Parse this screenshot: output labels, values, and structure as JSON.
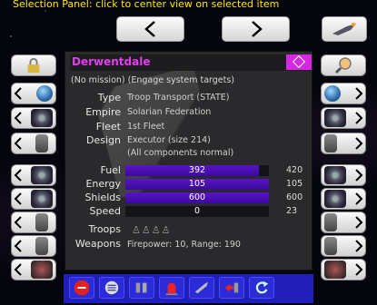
{
  "header": {
    "hint": "Selection Panel: click to center view on selected item"
  },
  "nav": {
    "prev_icon": "left-arrow-icon",
    "next_icon": "right-arrow-icon"
  },
  "item": {
    "name": "Derwentdale",
    "mission": "(No mission) (Engage system targets)",
    "fields": [
      {
        "label": "Type",
        "value": "Troop Transport (STATE)"
      },
      {
        "label": "Empire",
        "value": "Solarian Federation"
      },
      {
        "label": "Fleet",
        "value": "1st Fleet"
      },
      {
        "label": "Design",
        "value": "Executor (size 214)"
      }
    ],
    "components": "(All components normal)",
    "stats": [
      {
        "label": "Fuel",
        "value": "392",
        "max": "420",
        "fraction": 0.93
      },
      {
        "label": "Energy",
        "value": "105",
        "max": "105",
        "fraction": 1.0
      },
      {
        "label": "Shields",
        "value": "600",
        "max": "600",
        "fraction": 1.0
      },
      {
        "label": "Speed",
        "value": "0",
        "max": "23",
        "fraction": 0.0
      }
    ],
    "troops_label": "Troops",
    "troops_value": "♙♙♙♙",
    "weapons_label": "Weapons",
    "weapons_value": "Firepower: 10, Range: 190"
  },
  "colors": {
    "title": "#e23cf0",
    "bar_fill": "#4a10b8",
    "toolbar": "#2020b8"
  },
  "left_buttons": [
    "lock-icon",
    "planet-icon",
    "ship-icon",
    "troop-icon",
    "ship-icon",
    "ship-icon",
    "troop-icon",
    "troop-icon",
    "base-icon"
  ],
  "right_buttons": [
    "zoom-icon",
    "planet-icon",
    "ship-icon",
    "troop-icon",
    "ship-icon",
    "ship-icon",
    "troop-icon",
    "troop-icon",
    "base-icon"
  ],
  "toolbar": [
    "stop-icon",
    "list-icon",
    "troops-icon",
    "alert-icon",
    "ship-icon",
    "transfer-icon",
    "refresh-icon"
  ]
}
